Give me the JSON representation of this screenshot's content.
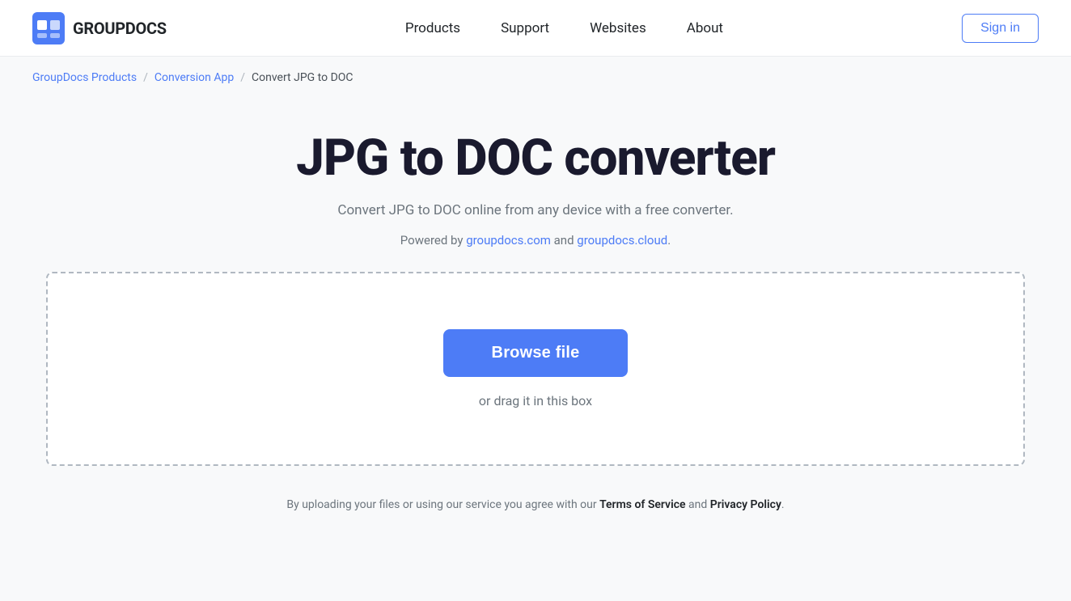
{
  "header": {
    "logo_text": "GROUPDOCS",
    "nav": {
      "products": "Products",
      "support": "Support",
      "websites": "Websites",
      "about": "About"
    },
    "sign_in": "Sign in"
  },
  "breadcrumb": {
    "item1": "GroupDocs Products",
    "item2": "Conversion App",
    "current": "Convert JPG to DOC"
  },
  "main": {
    "title": "JPG to DOC converter",
    "subtitle": "Convert JPG to DOC online from any device with a free converter.",
    "powered_by_prefix": "Powered by ",
    "powered_by_link1": "groupdocs.com",
    "powered_by_link1_url": "https://groupdocs.com",
    "powered_by_and": " and ",
    "powered_by_link2": "groupdocs.cloud",
    "powered_by_link2_url": "https://groupdocs.cloud",
    "powered_by_suffix": ".",
    "browse_button": "Browse file",
    "drag_text": "or drag it in this box"
  },
  "footer": {
    "prefix": "By uploading your files or using our service you agree with our ",
    "tos_link": "Terms of Service",
    "and": " and ",
    "privacy_link": "Privacy Policy",
    "suffix": "."
  },
  "colors": {
    "accent": "#4d7cf6",
    "text_primary": "#1a1a2e",
    "text_secondary": "#6c757d",
    "border": "#b0b8c1"
  }
}
